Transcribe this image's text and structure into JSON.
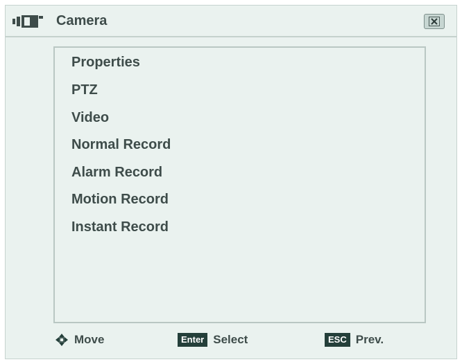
{
  "window": {
    "title": "Camera",
    "close_icon": "close-x-icon",
    "title_icon": "camera-icon"
  },
  "menu": {
    "items": [
      {
        "label": "Properties"
      },
      {
        "label": "PTZ"
      },
      {
        "label": "Video"
      },
      {
        "label": "Normal Record"
      },
      {
        "label": "Alarm Record"
      },
      {
        "label": "Motion Record"
      },
      {
        "label": "Instant Record"
      }
    ]
  },
  "footer": {
    "move_icon": "four-way-arrow-icon",
    "move_label": "Move",
    "enter_key": "Enter",
    "select_label": "Select",
    "esc_key": "ESC",
    "prev_label": "Prev."
  },
  "colors": {
    "background": "#eaf2ef",
    "text": "#3e4c4a",
    "keycap": "#243f3a",
    "border": "#b9c7c3"
  }
}
